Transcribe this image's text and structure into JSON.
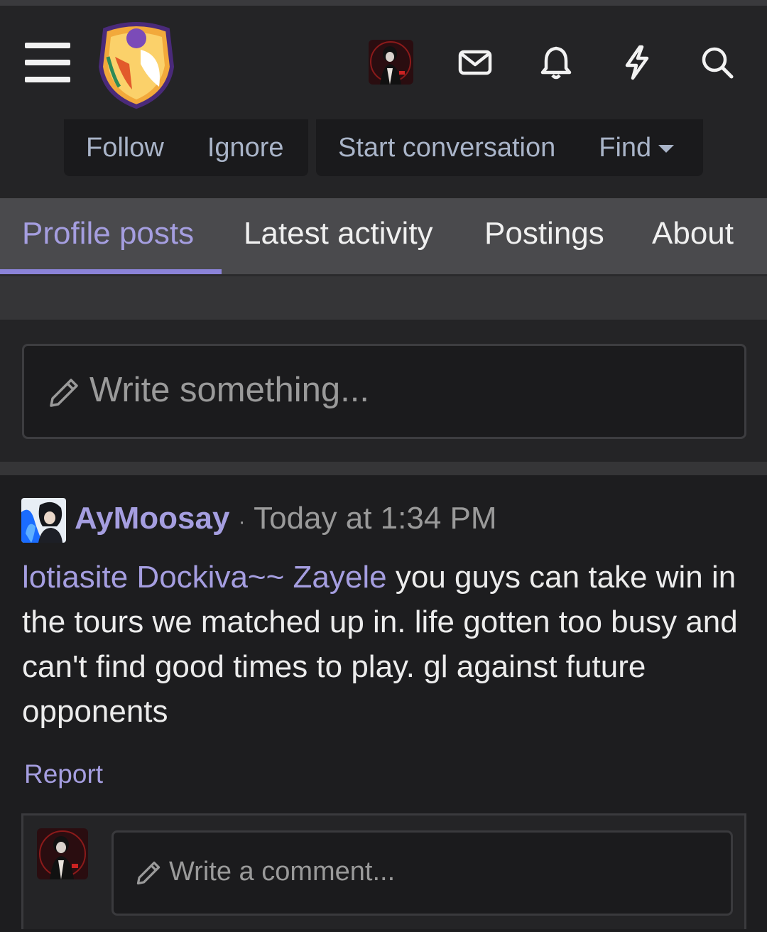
{
  "header": {
    "menu_icon": "hamburger-icon",
    "logo": "site-logo",
    "icons": [
      "mail-icon",
      "bell-icon",
      "lightning-icon",
      "search-icon"
    ]
  },
  "actions": {
    "follow": "Follow",
    "ignore": "Ignore",
    "start_conversation": "Start conversation",
    "find": "Find"
  },
  "tabs": [
    {
      "label": "Profile posts",
      "active": true
    },
    {
      "label": "Latest activity",
      "active": false
    },
    {
      "label": "Postings",
      "active": false
    },
    {
      "label": "About",
      "active": false
    }
  ],
  "composer": {
    "placeholder": "Write something..."
  },
  "post": {
    "username": "AyMoosay",
    "separator": "·",
    "timestamp": "Today at 1:34 PM",
    "mention1": "lotiasite",
    "mention2": "Dockiva~~",
    "mention3": "Zayele",
    "body": " you guys can take win in the tours we matched up in. life gotten too busy and can't find good times to play. gl against future opponents",
    "report": "Report",
    "comment_placeholder": "Write a comment..."
  },
  "colors": {
    "accent": "#a59ee0",
    "background": "#1d1d1f",
    "header": "#242426"
  }
}
